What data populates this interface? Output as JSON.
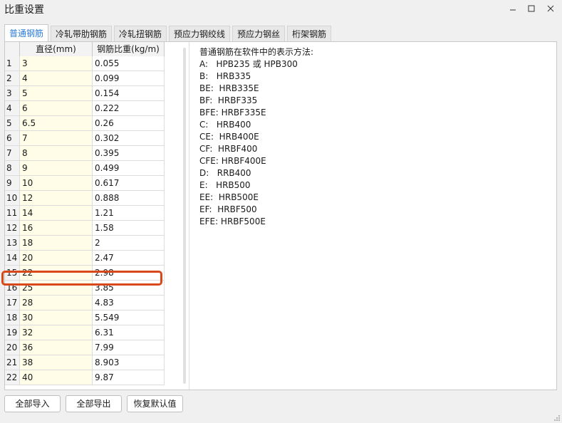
{
  "window": {
    "title": "比重设置"
  },
  "tabs": [
    {
      "label": "普通钢筋",
      "active": true
    },
    {
      "label": "冷轧带肋钢筋",
      "active": false
    },
    {
      "label": "冷轧扭钢筋",
      "active": false
    },
    {
      "label": "预应力钢绞线",
      "active": false
    },
    {
      "label": "预应力钢丝",
      "active": false
    },
    {
      "label": "桁架钢筋",
      "active": false
    }
  ],
  "table": {
    "columns": [
      "",
      "直径(mm)",
      "钢筋比重(kg/m)"
    ],
    "rows": [
      {
        "index": "1",
        "diameter": "3",
        "weight": "0.055"
      },
      {
        "index": "2",
        "diameter": "4",
        "weight": "0.099"
      },
      {
        "index": "3",
        "diameter": "5",
        "weight": "0.154"
      },
      {
        "index": "4",
        "diameter": "6",
        "weight": "0.222"
      },
      {
        "index": "5",
        "diameter": "6.5",
        "weight": "0.26"
      },
      {
        "index": "6",
        "diameter": "7",
        "weight": "0.302"
      },
      {
        "index": "7",
        "diameter": "8",
        "weight": "0.395"
      },
      {
        "index": "8",
        "diameter": "9",
        "weight": "0.499"
      },
      {
        "index": "9",
        "diameter": "10",
        "weight": "0.617"
      },
      {
        "index": "10",
        "diameter": "12",
        "weight": "0.888"
      },
      {
        "index": "11",
        "diameter": "14",
        "weight": "1.21"
      },
      {
        "index": "12",
        "diameter": "16",
        "weight": "1.58"
      },
      {
        "index": "13",
        "diameter": "18",
        "weight": "2"
      },
      {
        "index": "14",
        "diameter": "20",
        "weight": "2.47"
      },
      {
        "index": "15",
        "diameter": "22",
        "weight": "2.98"
      },
      {
        "index": "16",
        "diameter": "25",
        "weight": "3.85"
      },
      {
        "index": "17",
        "diameter": "28",
        "weight": "4.83"
      },
      {
        "index": "18",
        "diameter": "30",
        "weight": "5.549"
      },
      {
        "index": "19",
        "diameter": "32",
        "weight": "6.31"
      },
      {
        "index": "20",
        "diameter": "36",
        "weight": "7.99"
      },
      {
        "index": "21",
        "diameter": "38",
        "weight": "8.903"
      },
      {
        "index": "22",
        "diameter": "40",
        "weight": "9.87"
      }
    ],
    "highlighted_row": "18"
  },
  "info": {
    "heading": "普通钢筋在软件中的表示方法:",
    "lines": [
      "A:   HPB235 或 HPB300",
      "B:   HRB335",
      "BE:  HRB335E",
      "BF:  HRBF335",
      "BFE: HRBF335E",
      "C:   HRB400",
      "CE:  HRB400E",
      "CF:  HRBF400",
      "CFE: HRBF400E",
      "D:   RRB400",
      "E:   HRB500",
      "EE:  HRB500E",
      "EF:  HRBF500",
      "EFE: HRBF500E"
    ]
  },
  "buttons": {
    "import_all": "全部导入",
    "export_all": "全部导出",
    "restore_default": "恢复默认值"
  },
  "colors": {
    "accent": "#2a7bd6",
    "highlight_border": "#d9481a",
    "diameter_column_bg": "#fffde8"
  },
  "icons": {
    "minimize": "minimize-icon",
    "maximize": "maximize-icon",
    "close": "close-icon",
    "resize_grip": "resize-grip-icon"
  }
}
